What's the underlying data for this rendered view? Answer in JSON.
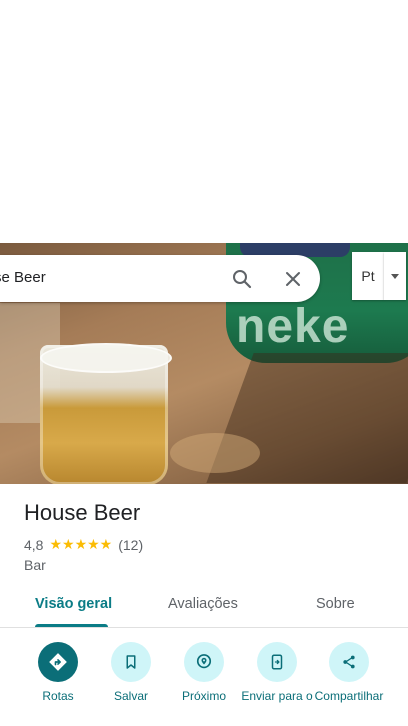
{
  "search": {
    "query": "se Beer"
  },
  "toolbar": {
    "button_label": "Pt"
  },
  "place": {
    "name": "House Beer",
    "rating": "4,8",
    "stars": "★★★★★",
    "review_count": "(12)",
    "category": "Bar"
  },
  "tabs": [
    {
      "label": "Visão geral",
      "active": true
    },
    {
      "label": "Avaliações",
      "active": false
    },
    {
      "label": "Sobre",
      "active": false
    }
  ],
  "actions": [
    {
      "label": "Rotas",
      "icon": "directions-icon"
    },
    {
      "label": "Salvar",
      "icon": "bookmark-icon"
    },
    {
      "label": "Próximo",
      "icon": "nearby-icon"
    },
    {
      "label": "Enviar para o",
      "icon": "send-to-phone-icon"
    },
    {
      "label": "Compartilhar",
      "icon": "share-icon"
    }
  ],
  "photo": {
    "can_text": "neke"
  },
  "colors": {
    "accent": "#0b7c86",
    "star": "#fbbc04",
    "action_bg": "#cff5f8"
  }
}
